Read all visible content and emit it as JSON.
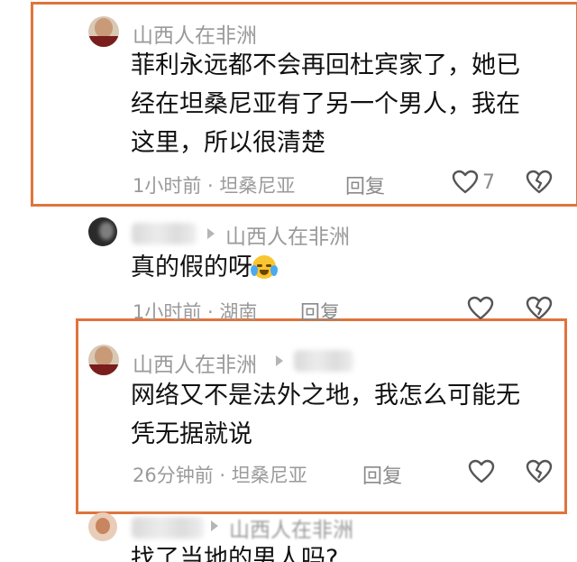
{
  "comments": [
    {
      "username": "山西人在非洲",
      "lines": [
        "菲利永远都不会再回杜宾家了，她已",
        "经在坦桑尼亚有了另一个男人，我在",
        "这里，所以很清楚"
      ],
      "meta": "1小时前 · 坦桑尼亚",
      "reply": "回复",
      "likes": "7"
    },
    {
      "username_blurred": "大 魔 王",
      "reply_to": "山西人在非洲",
      "lines": [
        "真的假的呀"
      ],
      "emoji": "crying-laughing-emoji",
      "meta": "1小时前 · 湖南",
      "reply": "回复"
    },
    {
      "username": "山西人在非洲",
      "reply_to_blurred": "大 魔 王",
      "lines": [
        "网络又不是法外之地，我怎么可能无",
        "凭无据就说"
      ],
      "meta": "26分钟前 · 坦桑尼亚",
      "reply": "回复"
    },
    {
      "username_blurred": "xiaomei",
      "reply_to": "山西人在非洲",
      "lines": [
        "找了当地的男人吗?"
      ]
    }
  ],
  "colors": {
    "highlight": "#e0743c",
    "muted": "#9a9a9a"
  }
}
